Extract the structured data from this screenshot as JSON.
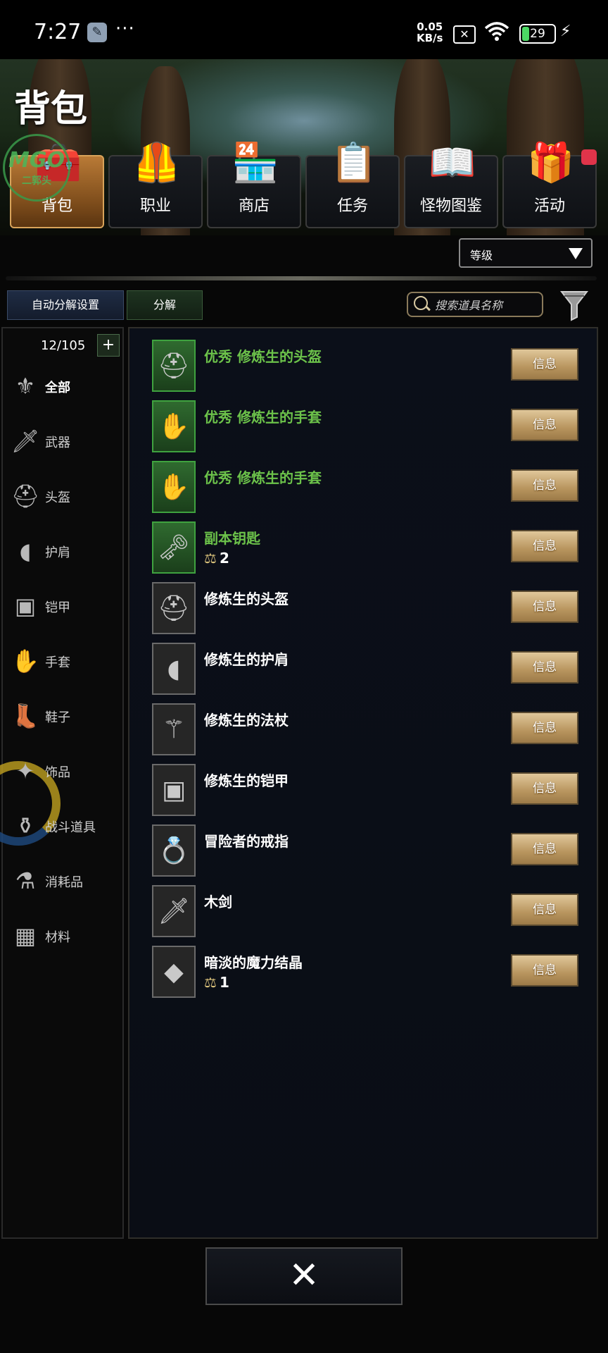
{
  "status_bar": {
    "time": "7:27",
    "dots": "···",
    "net_speed_value": "0.05",
    "net_speed_unit": "KB/s",
    "battery": "29"
  },
  "page_title": "背包",
  "tabs": [
    {
      "label": "背包",
      "icon": "treasure-chest-icon"
    },
    {
      "label": "职业",
      "icon": "armor-icon"
    },
    {
      "label": "商店",
      "icon": "shop-icon"
    },
    {
      "label": "任务",
      "icon": "clipboard-icon"
    },
    {
      "label": "怪物图鉴",
      "icon": "book-icon"
    },
    {
      "label": "活动",
      "icon": "gift-icon"
    }
  ],
  "watermark": {
    "text": "MGO",
    "sub": "二郭头"
  },
  "sort": {
    "selected": "等级"
  },
  "toolbar": {
    "auto_decompose": "自动分解设置",
    "decompose": "分解",
    "search_placeholder": "搜索道具名称"
  },
  "inventory_count": "12/105",
  "plus_label": "+",
  "categories": [
    {
      "label": "全部",
      "icon": "all-items-icon"
    },
    {
      "label": "武器",
      "icon": "sword-icon"
    },
    {
      "label": "头盔",
      "icon": "helmet-icon"
    },
    {
      "label": "护肩",
      "icon": "shoulder-guard-icon"
    },
    {
      "label": "铠甲",
      "icon": "armor-icon"
    },
    {
      "label": "手套",
      "icon": "glove-icon"
    },
    {
      "label": "鞋子",
      "icon": "boot-icon"
    },
    {
      "label": "饰品",
      "icon": "accessory-icon"
    },
    {
      "label": "战斗道具",
      "icon": "combat-item-icon"
    },
    {
      "label": "消耗品",
      "icon": "consumable-icon"
    },
    {
      "label": "材料",
      "icon": "material-icon"
    }
  ],
  "items": [
    {
      "name": "优秀 修炼生的头盔",
      "quality": "green",
      "icon": "helmet-icon",
      "qty": null,
      "button": "信息"
    },
    {
      "name": "优秀 修炼生的手套",
      "quality": "green",
      "icon": "glove-icon",
      "qty": null,
      "button": "信息"
    },
    {
      "name": "优秀 修炼生的手套",
      "quality": "green",
      "icon": "glove-icon",
      "qty": null,
      "button": "信息"
    },
    {
      "name": "副本钥匙",
      "quality": "green",
      "icon": "key-icon",
      "qty": "2",
      "button": "信息"
    },
    {
      "name": "修炼生的头盔",
      "quality": "normal",
      "icon": "helmet-icon",
      "qty": null,
      "button": "信息"
    },
    {
      "name": "修炼生的护肩",
      "quality": "normal",
      "icon": "shoulder-guard-icon",
      "qty": null,
      "button": "信息"
    },
    {
      "name": "修炼生的法杖",
      "quality": "normal",
      "icon": "staff-icon",
      "qty": null,
      "button": "信息"
    },
    {
      "name": "修炼生的铠甲",
      "quality": "normal",
      "icon": "armor-icon",
      "qty": null,
      "button": "信息"
    },
    {
      "name": "冒险者的戒指",
      "quality": "normal",
      "icon": "ring-icon",
      "qty": null,
      "button": "信息"
    },
    {
      "name": "木剑",
      "quality": "normal",
      "icon": "sword-icon",
      "qty": null,
      "button": "信息"
    },
    {
      "name": "暗淡的魔力结晶",
      "quality": "normal",
      "icon": "crystal-icon",
      "qty": "1",
      "button": "信息"
    }
  ],
  "close_label": "✕",
  "colors": {
    "rare_green": "#6cc24a",
    "active_tab": "#b97a36",
    "info_button": "#c9a872",
    "notification": "#e0344a"
  }
}
